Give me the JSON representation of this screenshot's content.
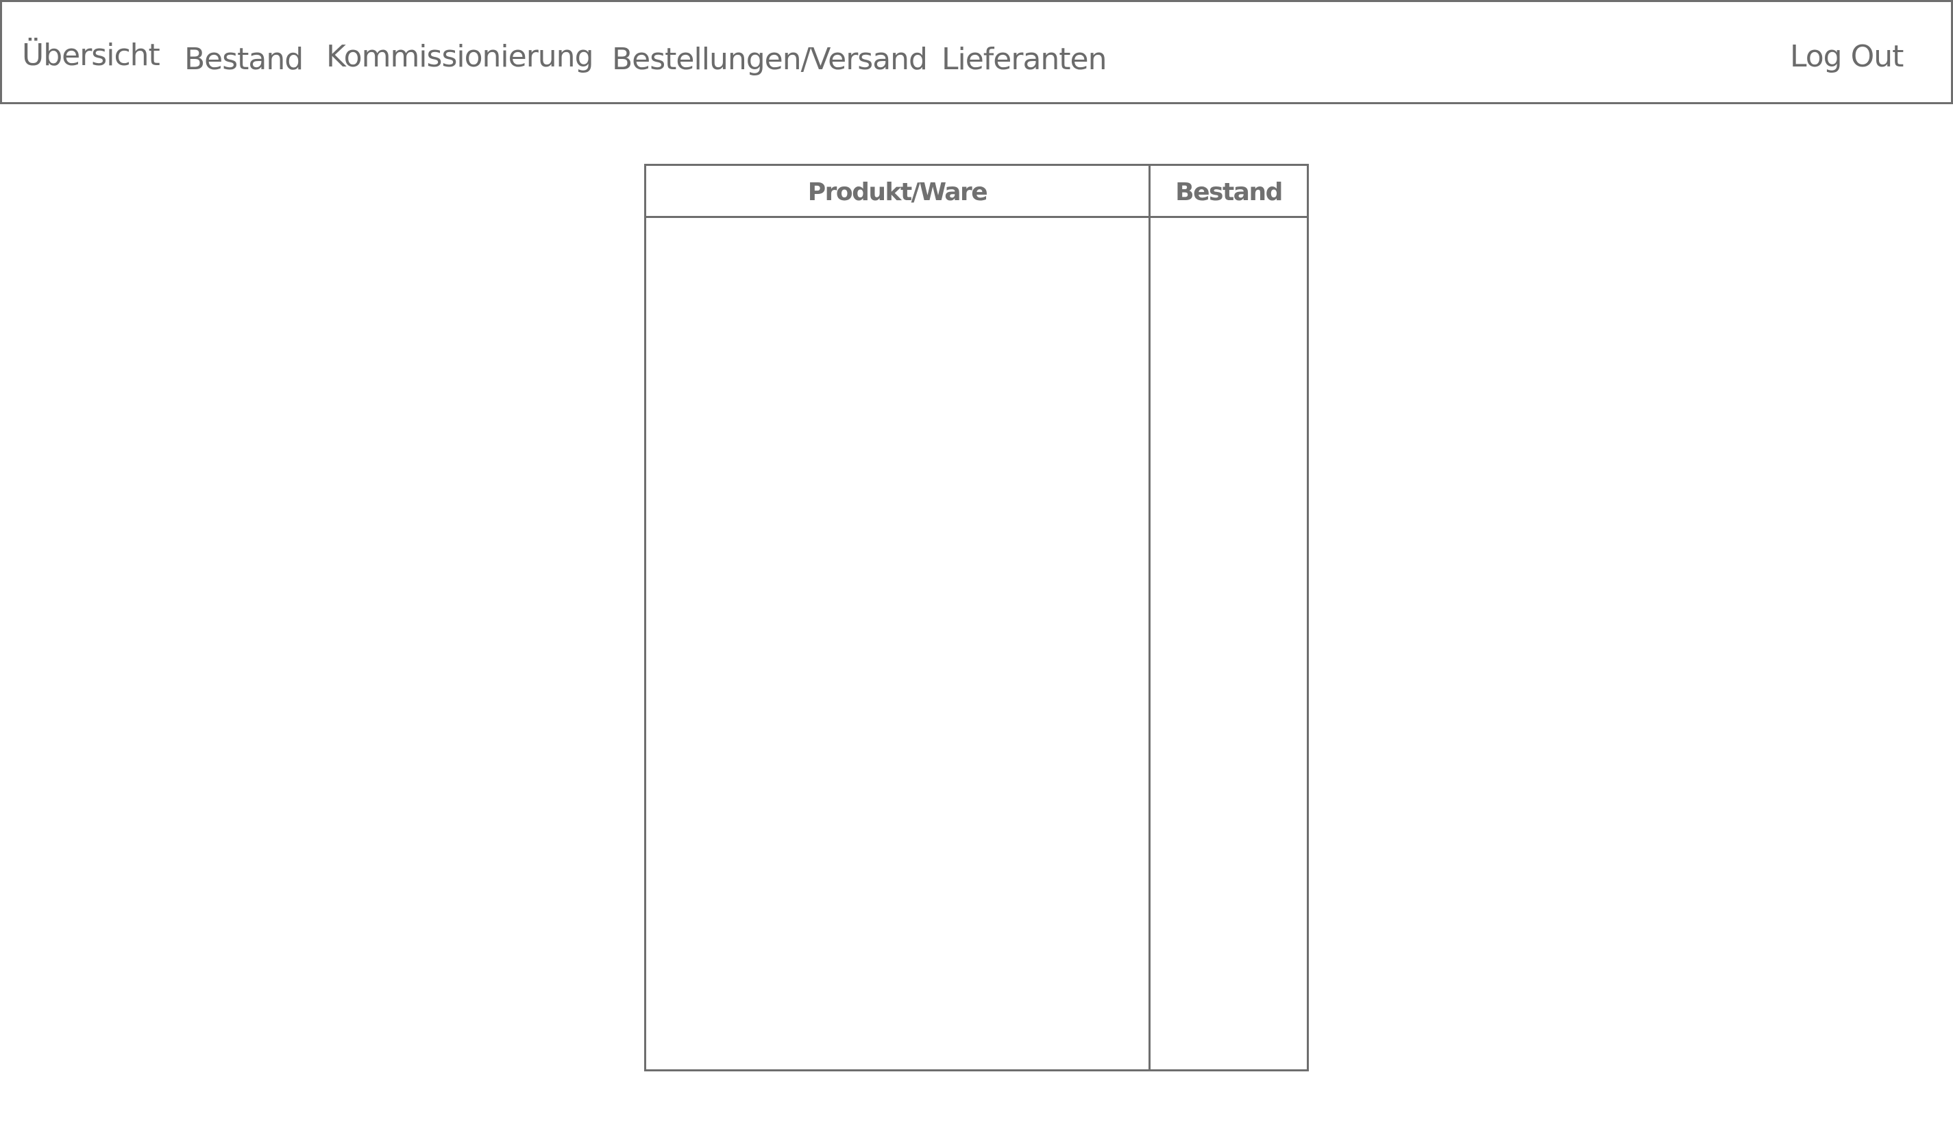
{
  "nav": {
    "items": [
      {
        "label": "Übersicht"
      },
      {
        "label": "Bestand"
      },
      {
        "label": "Kommissionierung"
      },
      {
        "label": "Bestellungen/Versand"
      },
      {
        "label": "Lieferanten"
      }
    ],
    "logout_label": "Log Out"
  },
  "inventory_table": {
    "columns": [
      "Produkt/Ware",
      "Bestand"
    ],
    "rows": []
  },
  "colors": {
    "border": "#6e6e6e",
    "text": "#6b6b6b",
    "background": "#ffffff"
  }
}
